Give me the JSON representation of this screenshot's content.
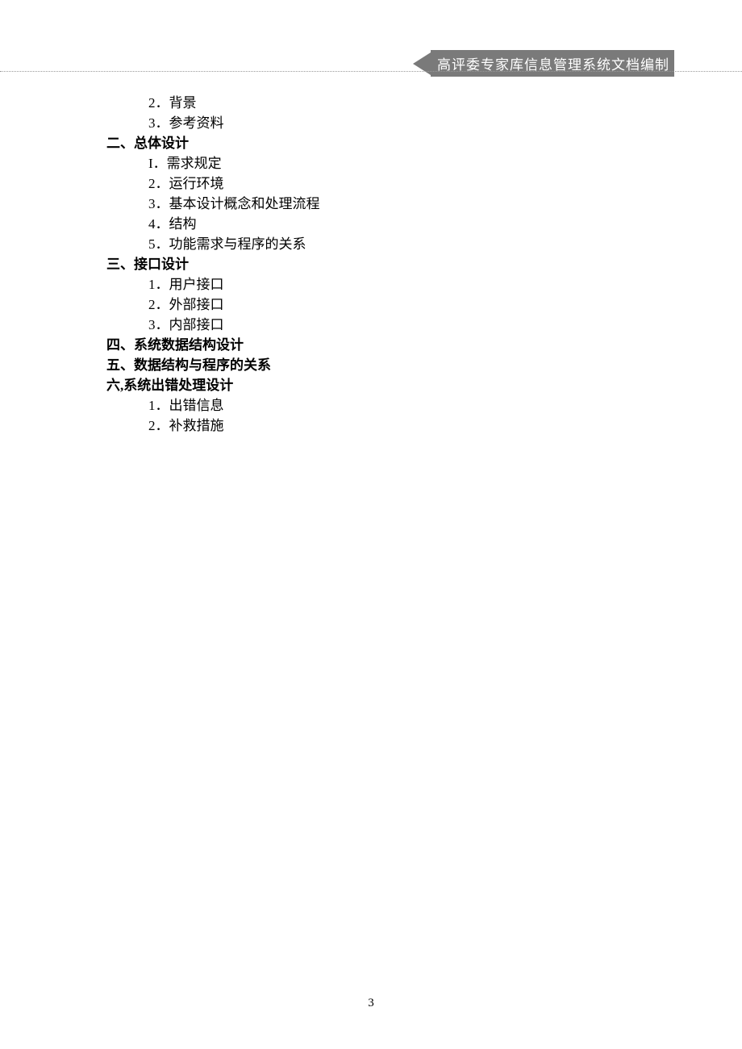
{
  "header": {
    "banner_text": "高评委专家库信息管理系统文档编制"
  },
  "outline": {
    "pre_items": [
      "2．背景",
      "3．参考资料"
    ],
    "sections": [
      {
        "title": "二、总体设计",
        "items": [
          "I．需求规定",
          "2．运行环境",
          "3．基本设计概念和处理流程",
          "4．结构",
          "5．功能需求与程序的关系"
        ]
      },
      {
        "title": "三、接口设计",
        "items": [
          "1．用户接口",
          "2．外部接口",
          "3．内部接口"
        ]
      },
      {
        "title": "四、系统数据结构设计",
        "items": []
      },
      {
        "title": "五、数据结构与程序的关系",
        "items": []
      },
      {
        "title": "六,系统出错处理设计",
        "items": [
          "1．出错信息",
          "2．补救措施"
        ]
      }
    ]
  },
  "page_number": "3"
}
